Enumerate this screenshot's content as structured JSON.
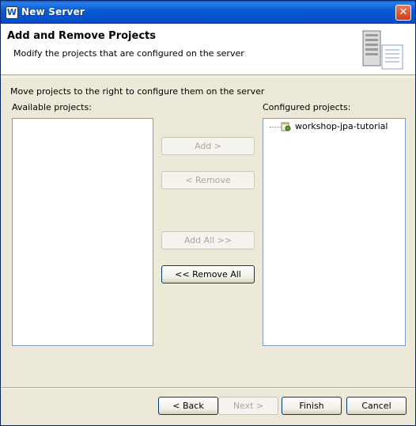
{
  "window": {
    "title": "New Server",
    "app_icon": "W"
  },
  "header": {
    "title": "Add and Remove Projects",
    "description": "Modify the projects that are configured on the server"
  },
  "instruction": "Move projects to the right to configure them on the server",
  "available": {
    "label": "Available projects:",
    "items": []
  },
  "configured": {
    "label": "Configured projects:",
    "items": [
      "workshop-jpa-tutorial"
    ]
  },
  "buttons": {
    "add": "Add >",
    "remove": "< Remove",
    "add_all": "Add All >>",
    "remove_all": "<< Remove All"
  },
  "footer": {
    "back": "< Back",
    "next": "Next >",
    "finish": "Finish",
    "cancel": "Cancel"
  }
}
